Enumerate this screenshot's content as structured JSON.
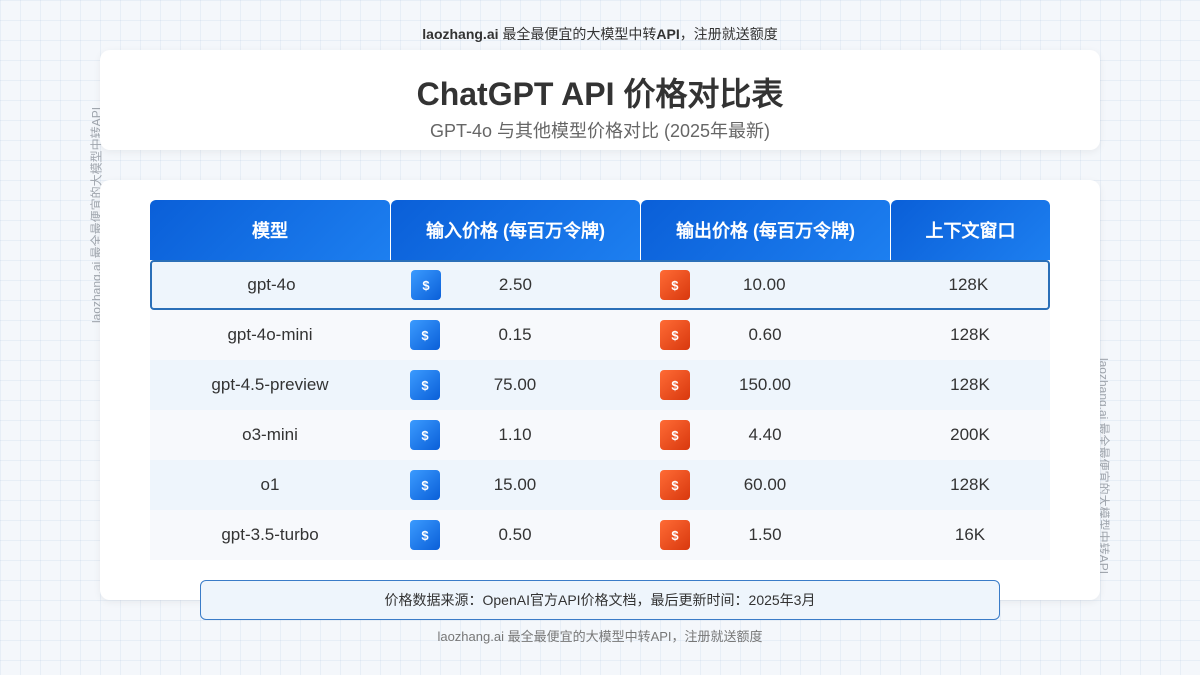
{
  "banner": {
    "brand": "laozhang.ai",
    "text": " 最全最便宜的大模型中转",
    "api": "API",
    "suffix": "，注册就送额度"
  },
  "watermark": "laozhang.ai 最全最便宜的大模型中转API",
  "header": {
    "title": "ChatGPT API 价格对比表",
    "subtitle": "GPT-4o 与其他模型价格对比 (2025年最新)"
  },
  "table": {
    "columns": [
      "模型",
      "输入价格 (每百万令牌)",
      "输出价格 (每百万令牌)",
      "上下文窗口"
    ],
    "badge_symbol": "$",
    "rows": [
      {
        "model": "gpt-4o",
        "input": "2.50",
        "output": "10.00",
        "context": "128K"
      },
      {
        "model": "gpt-4o-mini",
        "input": "0.15",
        "output": "0.60",
        "context": "128K"
      },
      {
        "model": "gpt-4.5-preview",
        "input": "75.00",
        "output": "150.00",
        "context": "128K"
      },
      {
        "model": "o3-mini",
        "input": "1.10",
        "output": "4.40",
        "context": "200K"
      },
      {
        "model": "o1",
        "input": "15.00",
        "output": "60.00",
        "context": "128K"
      },
      {
        "model": "gpt-3.5-turbo",
        "input": "0.50",
        "output": "1.50",
        "context": "16K"
      }
    ]
  },
  "note": "价格数据来源：OpenAI官方API价格文档，最后更新时间：2025年3月",
  "footer": "laozhang.ai 最全最便宜的大模型中转API，注册就送额度",
  "colors": {
    "header_blue": "#0a5fd8",
    "input_badge": "#1d7ff0",
    "output_badge": "#e8471a",
    "highlight_border": "#2a6fb8"
  }
}
